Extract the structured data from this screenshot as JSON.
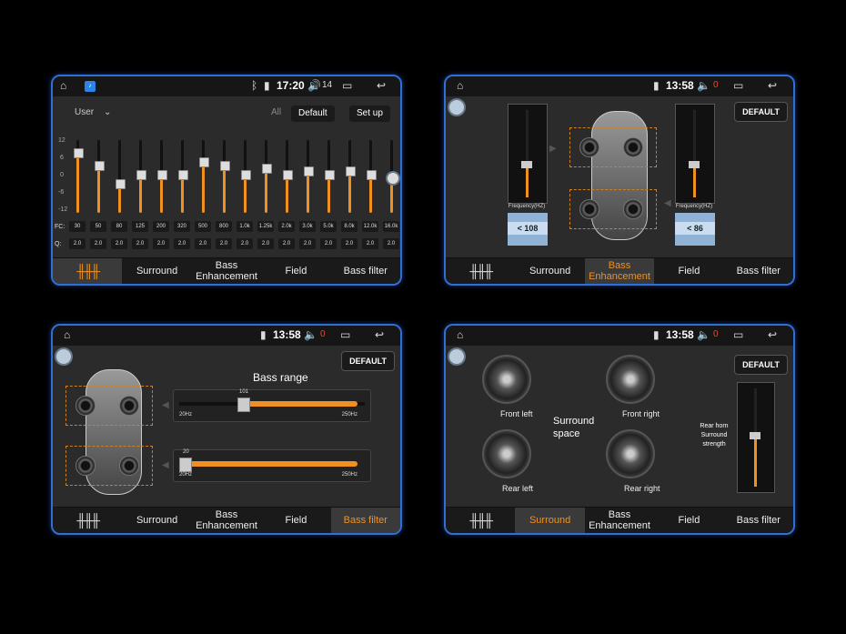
{
  "panel1": {
    "status": {
      "time": "17:20",
      "volume": "14"
    },
    "preset_label": "User",
    "buttons": {
      "all": "All",
      "default": "Default",
      "setup": "Set up"
    },
    "scale": [
      "12",
      "6",
      "0",
      "-6",
      "-12"
    ],
    "fc_label": "FC:",
    "q_label": "Q:",
    "frequencies": [
      "30",
      "50",
      "80",
      "125",
      "200",
      "320",
      "500",
      "800",
      "1.0k",
      "1.25k",
      "2.0k",
      "3.0k",
      "5.0k",
      "8.0k",
      "12.0k",
      "16.0k"
    ],
    "q_values": [
      "2.0",
      "2.0",
      "2.0",
      "2.0",
      "2.0",
      "2.0",
      "2.0",
      "2.0",
      "2.0",
      "2.0",
      "2.0",
      "2.0",
      "2.0",
      "2.0",
      "2.0",
      "2.0"
    ],
    "levels": [
      8,
      4,
      -2,
      1,
      1,
      1,
      5,
      4,
      1,
      3,
      1,
      2,
      1,
      2,
      1,
      0
    ],
    "tabs": [
      "",
      "Surround",
      "Bass Enhancement",
      "Field",
      "Bass filter"
    ],
    "active_tab": 0
  },
  "panel2": {
    "status": {
      "time": "13:58",
      "volume": "0"
    },
    "default": "DEFAULT",
    "freq_label": "Frequency(HZ)",
    "left_freq": "108",
    "left_above": "",
    "left_below": "",
    "right_freq": "86",
    "right_above": "",
    "right_below": "",
    "tabs": [
      "",
      "Surround",
      "Bass Enhancement",
      "Field",
      "Bass filter"
    ],
    "active_tab": 2
  },
  "panel3": {
    "status": {
      "time": "13:58",
      "volume": "0"
    },
    "default": "DEFAULT",
    "title": "Bass range",
    "slider1": {
      "value": "101",
      "min": "20Hz",
      "max": "250Hz"
    },
    "slider2": {
      "value": "20",
      "min": "20Hz",
      "max": "250Hz"
    },
    "tabs": [
      "",
      "Surround",
      "Bass Enhancement",
      "Field",
      "Bass filter"
    ],
    "active_tab": 4
  },
  "panel4": {
    "status": {
      "time": "13:58",
      "volume": "0"
    },
    "default": "DEFAULT",
    "front_left": "Front left",
    "front_right": "Front right",
    "rear_left": "Rear left",
    "rear_right": "Rear right",
    "surround_space": "Surround space",
    "rear_horn": "Rear horn Surround strength",
    "tabs": [
      "",
      "Surround",
      "Bass Enhancement",
      "Field",
      "Bass filter"
    ],
    "active_tab": 1
  },
  "colors": {
    "accent": "#f09020",
    "border": "#2f6fd8",
    "volume_muted": "#e43333"
  }
}
